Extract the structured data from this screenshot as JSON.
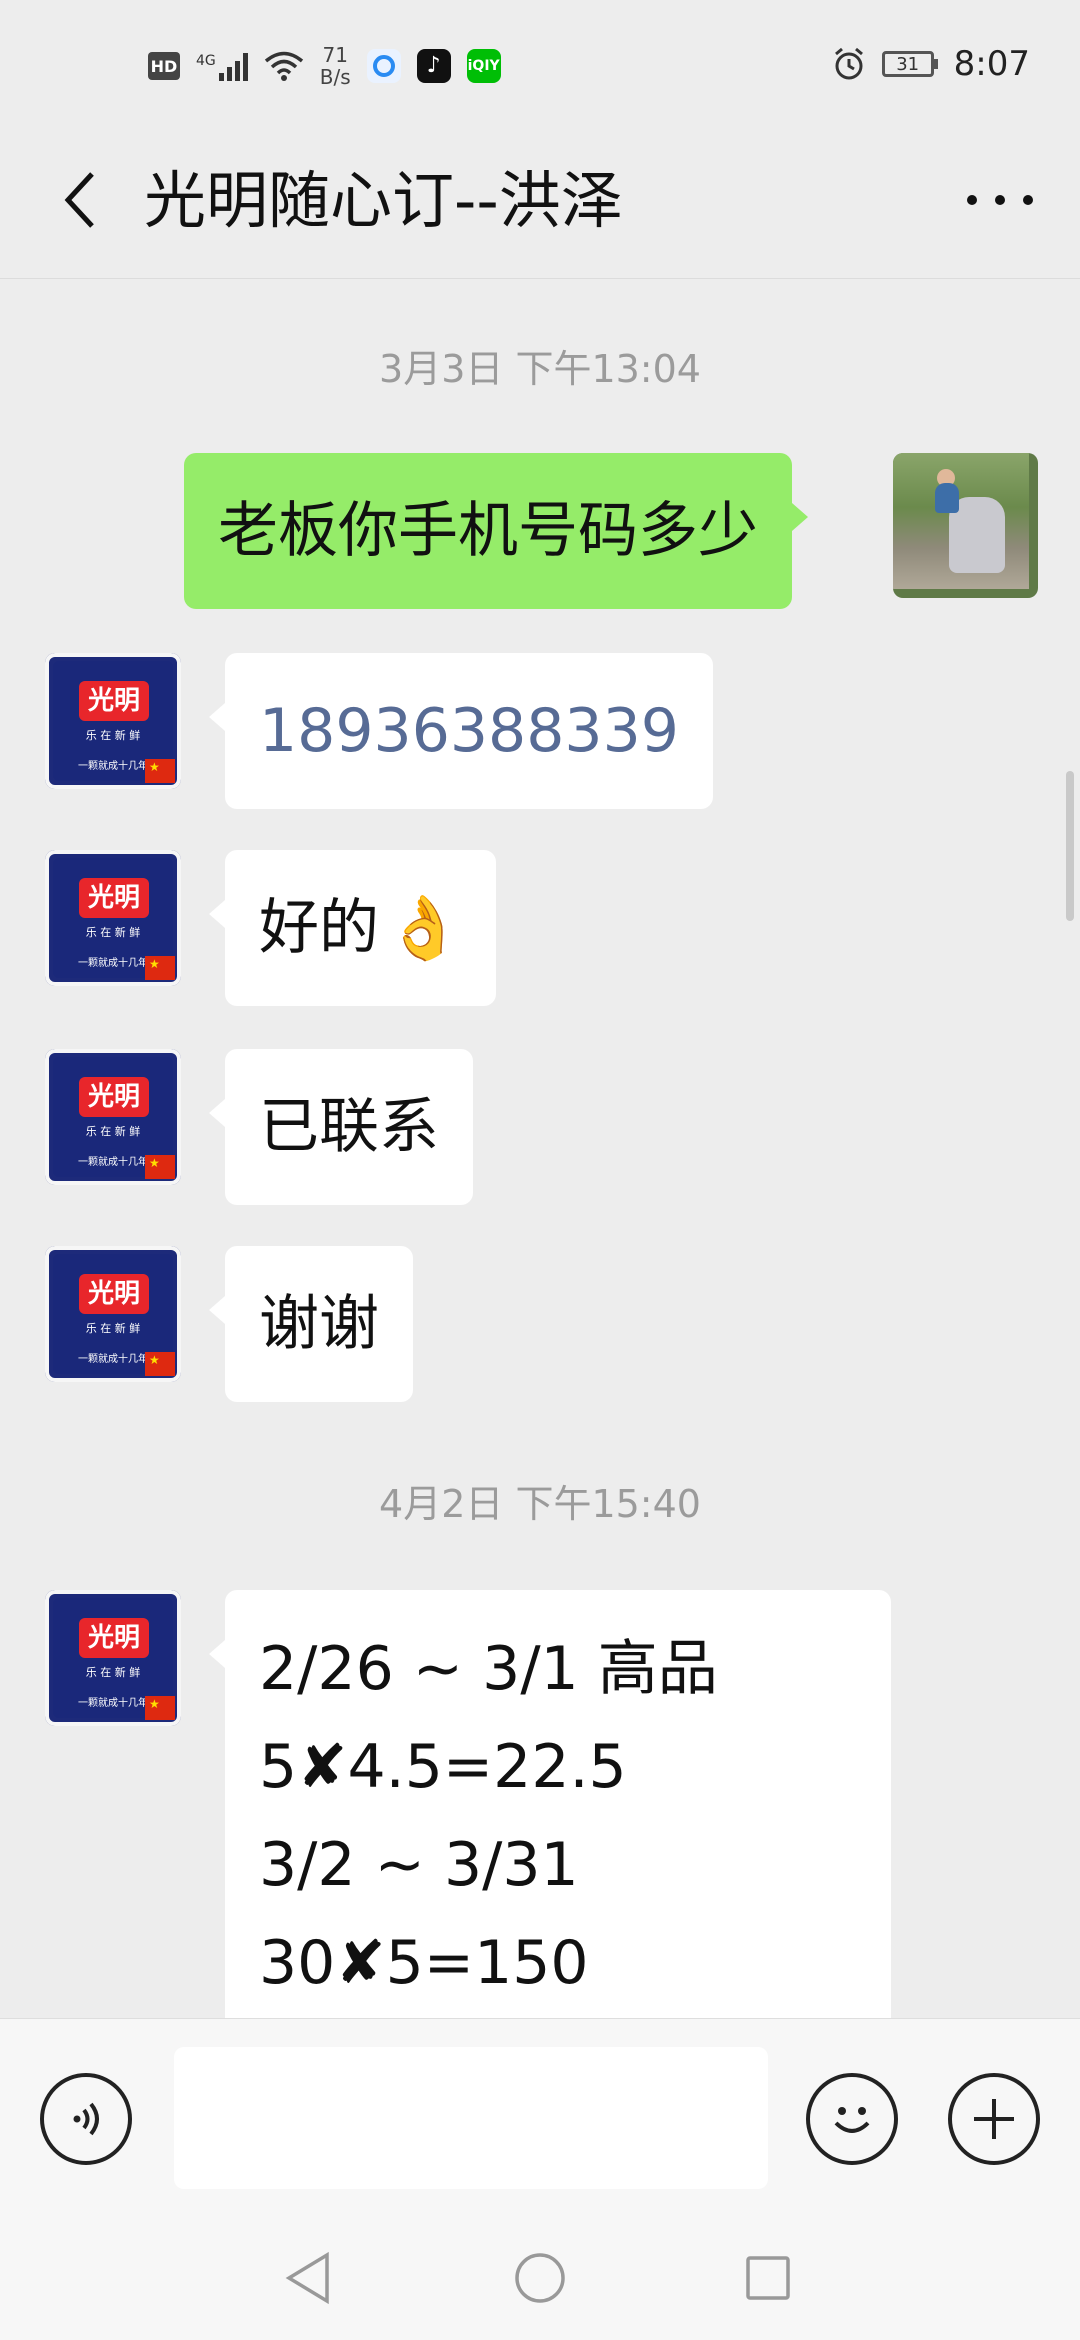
{
  "status_bar": {
    "hd_label": "HD",
    "network_label": "4G",
    "speed_value": "71",
    "speed_unit": "B/s",
    "battery_level": "31",
    "time": "8:07",
    "app_icons": [
      "browser-icon",
      "tiktok-icon",
      "iqiyi-icon"
    ]
  },
  "header": {
    "title": "光明随心订--洪泽"
  },
  "messages": {
    "timestamp1": "3月3日 下午13:04",
    "m1_text": "老板你手机号码多少",
    "m2_text": "18936388339",
    "m3_text": "好的",
    "m3_emoji": "👌",
    "m4_text": "已联系",
    "m5_text": "谢谢",
    "timestamp2": "4月2日 下午15:40",
    "m6_lines": [
      "2/26 ~ 3/1  高品",
      "5✘4.5=22.5",
      "3/2 ~ 3/31",
      "30✘5=150"
    ]
  },
  "brand_avatar": {
    "logo_text": "光明",
    "tagline": "乐 在 新 鲜",
    "slogan": "一颗就成十几年"
  },
  "colors": {
    "background": "#ededed",
    "sent_bubble": "#95ec69",
    "received_bubble": "#ffffff",
    "link_number": "#576b95"
  }
}
